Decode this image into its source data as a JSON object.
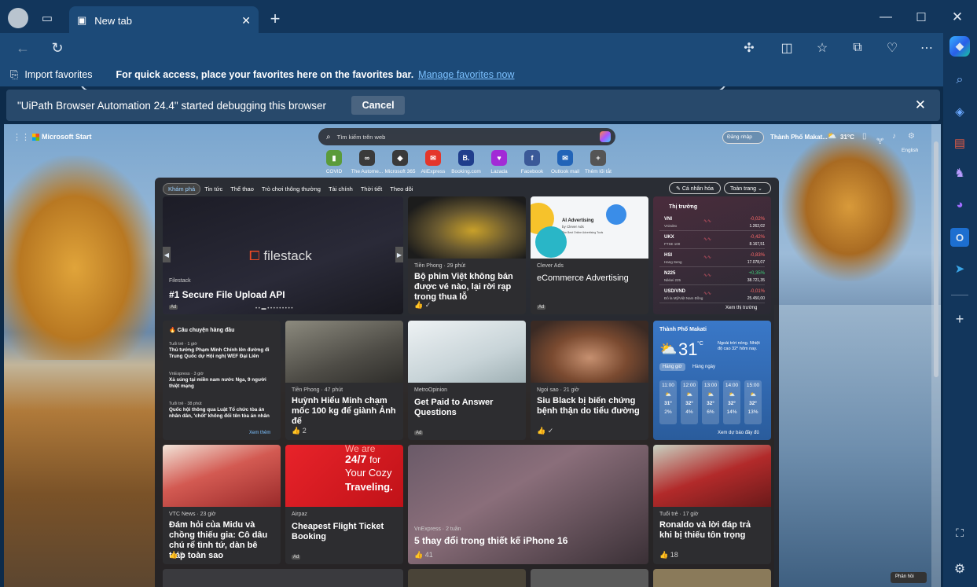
{
  "browser": {
    "tab_title": "New tab",
    "address_value": "",
    "fav_import": "Import favorites",
    "fav_hint": "For quick access, place your favorites here on the favorites bar.",
    "fav_manage": "Manage favorites now",
    "info_text": "\"UiPath Browser Automation 24.4\" started debugging this browser",
    "cancel": "Cancel"
  },
  "msn": {
    "brand": "Microsoft Start",
    "search_placeholder": "Tìm kiếm trên web",
    "signin": "Đăng nhập",
    "location": "Thành Phố Makat...",
    "temp": "31°C",
    "lang": "English",
    "shortcuts": [
      {
        "label": "COVID",
        "color": "#5b9b3a",
        "glyph": "▮"
      },
      {
        "label": "The Autome...",
        "color": "#3a3a3a",
        "glyph": "∞"
      },
      {
        "label": "Microsoft 365",
        "color": "#3a3a3a",
        "glyph": "◆"
      },
      {
        "label": "AliExpress",
        "color": "#e4362b",
        "glyph": "✉"
      },
      {
        "label": "Booking.com",
        "color": "#1f3d8c",
        "glyph": "B."
      },
      {
        "label": "Lazada",
        "color": "#a22bd6",
        "glyph": "♥"
      },
      {
        "label": "Facebook",
        "color": "#3b5998",
        "glyph": "f"
      },
      {
        "label": "Outlook mail",
        "color": "#2264b8",
        "glyph": "✉"
      },
      {
        "label": "Thêm lối tắt",
        "color": "#555",
        "glyph": "+"
      }
    ],
    "tabs": [
      "Khám phá",
      "Tin tức",
      "Thể thao",
      "Trò chơi thông thường",
      "Tài chính",
      "Thời tiết",
      "Theo dõi"
    ],
    "personalize": "Cá nhân hóa",
    "view": "Toàn trang"
  },
  "cards": {
    "hero": {
      "logo": "filestack",
      "source": "Filestack",
      "headline": "#1 Secure File Upload API",
      "ad": "Ad"
    },
    "c2": {
      "source": "Tiền Phong · 29 phút",
      "headline": "Bộ phim Việt không bán được vé nào, lại rời rạp trong thua lỗ"
    },
    "c3": {
      "source": "Clever Ads",
      "headline": "eCommerce Advertising",
      "ad": "Ad",
      "img_title": "AI Advertising",
      "img_sub": "by Clever Ads",
      "img_line": "The Best Online Advertising Tools"
    },
    "market": {
      "title": "Thị trường",
      "rows": [
        {
          "n": "VNI",
          "s": "Vnindex",
          "c": "-0,02%",
          "v": "1.262,02"
        },
        {
          "n": "UKX",
          "s": "FTSE 100",
          "c": "-0,42%",
          "v": "8.167,51"
        },
        {
          "n": "HSI",
          "s": "Hang Seng",
          "c": "-0,83%",
          "v": "17.078,07"
        },
        {
          "n": "N225",
          "s": "Nikkei 225",
          "c": "+0,35%",
          "v": "38.721,35"
        },
        {
          "n": "USD/VND",
          "s": "Đô la Mỹ/Việt Nam Đồng",
          "c": "-0,01%",
          "v": "25.450,00"
        }
      ],
      "more": "Xem thị trường"
    },
    "top": {
      "title": "Câu chuyện hàng đầu",
      "items": [
        {
          "src": "Tuổi trẻ · 1 giờ",
          "t": "Thủ tướng Phạm Minh Chính lên đường đi Trung Quốc dự Hội nghị WEF Đại Liên"
        },
        {
          "src": "VnExpress · 3 giờ",
          "t": "Xả súng tại miền nam nước Nga, 9 người thiệt mạng"
        },
        {
          "src": "Tuổi trẻ · 38 phút",
          "t": "Quốc hội thông qua Luật Tổ chức tòa án nhân dân, 'chốt' không đổi tên tòa án nhân"
        }
      ],
      "more": "Xem thêm"
    },
    "c6": {
      "source": "Tiền Phong · 47 phút",
      "headline": "Huỳnh Hiểu Minh chạm mốc 100 kg để giành Ảnh đế",
      "likes": "2"
    },
    "c7": {
      "source": "MetroOpinion",
      "headline": "Get Paid to Answer Questions",
      "ad": "Ad"
    },
    "c8": {
      "source": "Ngoi sao · 21 giờ",
      "headline": "Siu Black bị biến chứng bệnh thận do tiểu đường"
    },
    "weather": {
      "city": "Thành Phố Makati",
      "temp": "31",
      "unit": "°C",
      "note": "Ngoài trời nóng. Nhiệt độ cao 32° hôm nay.",
      "tab1": "Hàng giờ",
      "tab2": "Hàng ngày",
      "hours": [
        "11:00",
        "12:00",
        "13:00",
        "14:00",
        "15:00"
      ],
      "temps": [
        "31°",
        "32°",
        "32°",
        "32°",
        "32°"
      ],
      "rain": [
        "2%",
        "4%",
        "6%",
        "14%",
        "13%"
      ],
      "more": "Xem dự báo đầy đủ"
    },
    "c10": {
      "source": "VTC News · 23 giờ",
      "headline": "Đám hỏi của Midu và chồng thiếu gia: Cô dâu chú rể tình tứ, dàn bê tráp toàn sao",
      "likes": "2"
    },
    "c11": {
      "source": "Airpaz",
      "headline": "Cheapest Flight Ticket Booking",
      "ad": "Ad",
      "img1": "We are",
      "img2": "24/7",
      "img3": "for",
      "img4": "Your Cozy",
      "img5": "Traveling."
    },
    "c12": {
      "source": "VnExpress · 2 tuần",
      "headline": "5 thay đổi trong thiết kế iPhone 16",
      "likes": "41"
    },
    "c13": {
      "source": "Tuổi trẻ · 17 giờ",
      "headline": "Ronaldo và lời đáp trả khi bị thiếu tôn trọng",
      "likes": "18"
    },
    "feedback": "Phản hồi"
  }
}
